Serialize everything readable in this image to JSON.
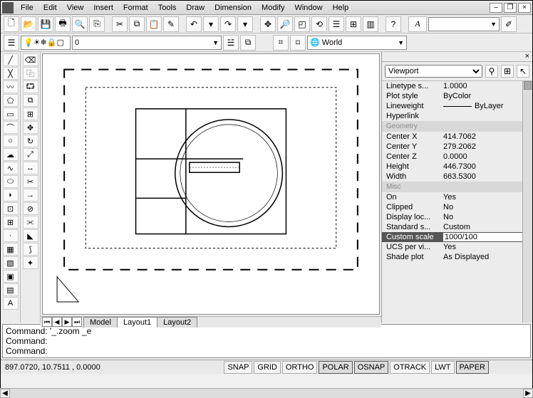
{
  "menus": [
    "File",
    "Edit",
    "View",
    "Insert",
    "Format",
    "Tools",
    "Draw",
    "Dimension",
    "Modify",
    "Window",
    "Help"
  ],
  "layer_toolbar": {
    "layer_combo": "0",
    "coord_sys": "World"
  },
  "props": {
    "selector": "Viewport",
    "general": [
      {
        "k": "Linetype s...",
        "v": "1.0000"
      },
      {
        "k": "Plot style",
        "v": "ByColor"
      },
      {
        "k": "Lineweight",
        "v": "—— ByLayer",
        "swatch": true
      },
      {
        "k": "Hyperlink",
        "v": ""
      }
    ],
    "geom_title": "Geometry",
    "geometry": [
      {
        "k": "Center X",
        "v": "414.7062"
      },
      {
        "k": "Center Y",
        "v": "279.2062"
      },
      {
        "k": "Center Z",
        "v": "0.0000"
      },
      {
        "k": "Height",
        "v": "446.7300"
      },
      {
        "k": "Width",
        "v": "663.5300"
      }
    ],
    "misc_title": "Misc",
    "misc": [
      {
        "k": "On",
        "v": "Yes"
      },
      {
        "k": "Clipped",
        "v": "No"
      },
      {
        "k": "Display loc...",
        "v": "No"
      },
      {
        "k": "Standard s...",
        "v": "Custom"
      },
      {
        "k": "Custom scale",
        "v": "1000/100",
        "active": true
      },
      {
        "k": "UCS per vi...",
        "v": "Yes"
      },
      {
        "k": "Shade plot",
        "v": "As Displayed"
      }
    ]
  },
  "tabs": [
    "Model",
    "Layout1",
    "Layout2"
  ],
  "active_tab": 1,
  "command_lines": [
    "Command: '_.zoom _e",
    "Command:",
    "Command:"
  ],
  "status": {
    "coords": "897.0720, 10.7511 , 0.0000",
    "toggles": [
      "SNAP",
      "GRID",
      "ORTHO",
      "POLAR",
      "OSNAP",
      "OTRACK",
      "LWT",
      "PAPER"
    ]
  },
  "font_combo": "A"
}
